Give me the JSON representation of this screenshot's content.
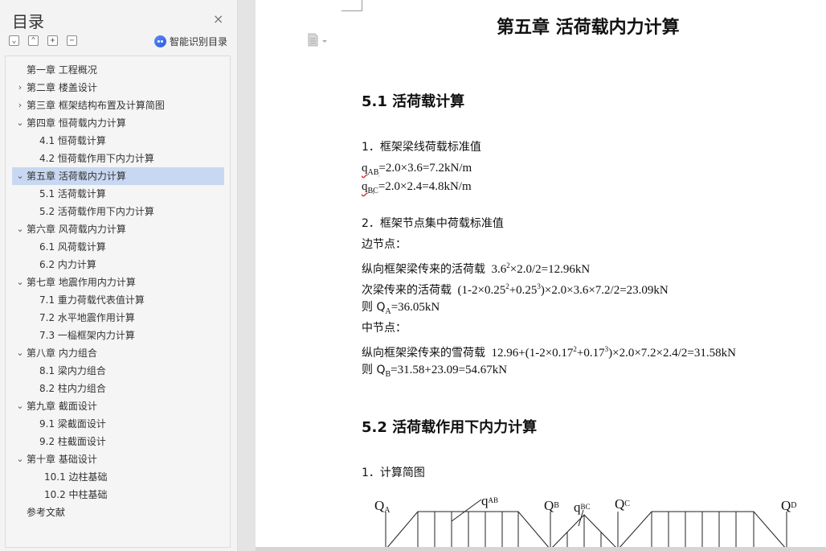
{
  "nav": {
    "title": "目录",
    "close_glyph": "×",
    "toolbar": {
      "collapse_all": "⌄",
      "expand_up": "⌃",
      "add": "+",
      "remove": "−"
    },
    "smart_toc_label": "智能识别目录",
    "toc": [
      {
        "text": "第一章  工程概况",
        "level": 1,
        "arrow": ""
      },
      {
        "text": "第二章  楼盖设计",
        "level": 1,
        "arrow": "›"
      },
      {
        "text": "第三章  框架结构布置及计算简图",
        "level": 1,
        "arrow": "›"
      },
      {
        "text": "第四章  恒荷载内力计算",
        "level": 1,
        "arrow": "⌄"
      },
      {
        "text": "4.1  恒荷载计算",
        "level": 2,
        "arrow": ""
      },
      {
        "text": "4.2  恒荷载作用下内力计算",
        "level": 2,
        "arrow": ""
      },
      {
        "text": "第五章  活荷载内力计算",
        "level": 1,
        "arrow": "⌄",
        "selected": true
      },
      {
        "text": "5.1  活荷载计算",
        "level": 2,
        "arrow": ""
      },
      {
        "text": "5.2  活荷载作用下内力计算",
        "level": 2,
        "arrow": ""
      },
      {
        "text": "第六章  风荷载内力计算",
        "level": 1,
        "arrow": "⌄"
      },
      {
        "text": "6.1  风荷载计算",
        "level": 2,
        "arrow": ""
      },
      {
        "text": "6.2  内力计算",
        "level": 2,
        "arrow": ""
      },
      {
        "text": "第七章  地震作用内力计算",
        "level": 1,
        "arrow": "⌄"
      },
      {
        "text": "7.1  重力荷载代表值计算",
        "level": 2,
        "arrow": ""
      },
      {
        "text": "7.2  水平地震作用计算",
        "level": 2,
        "arrow": ""
      },
      {
        "text": "7.3  一榀框架内力计算",
        "level": 2,
        "arrow": ""
      },
      {
        "text": "第八章  内力组合",
        "level": 1,
        "arrow": "⌄"
      },
      {
        "text": "8.1  梁内力组合",
        "level": 2,
        "arrow": ""
      },
      {
        "text": "8.2  柱内力组合",
        "level": 2,
        "arrow": ""
      },
      {
        "text": "第九章  截面设计",
        "level": 1,
        "arrow": "⌄"
      },
      {
        "text": "9.1  梁截面设计",
        "level": 2,
        "arrow": ""
      },
      {
        "text": "9.2  柱截面设计",
        "level": 2,
        "arrow": ""
      },
      {
        "text": "第十章  基础设计",
        "level": 1,
        "arrow": "⌄"
      },
      {
        "text": "10.1  边柱基础",
        "level": 3,
        "arrow": ""
      },
      {
        "text": "10.2  中柱基础",
        "level": 3,
        "arrow": ""
      },
      {
        "text": "参考文献",
        "level": 1,
        "arrow": ""
      }
    ]
  },
  "doc": {
    "chapter_title": "第五章  活荷载内力计算",
    "section1_title": "5.1  活荷载计算",
    "item1": "1．框架梁线荷载标准值",
    "qab_q": "q",
    "qab_sub": "AB",
    "qab_rest": "=2.0×3.6=7.2kN/m",
    "qbc_q": "q",
    "qbc_sub": "BC",
    "qbc_rest": "=2.0×2.4=4.8kN/m",
    "item2": "2．框架节点集中荷载标准值",
    "edge_node": "边节点：",
    "l1_label": "纵向框架梁传来的活荷载",
    "l1_a": "3.6",
    "l1_sup": "2",
    "l1_b": "×2.0/2=12.96kN",
    "l2_label": "次梁传来的活荷载",
    "l2_a": "(1-2×0.25",
    "l2_sup1": "2",
    "l2_b": "+0.25",
    "l2_sup2": "3",
    "l2_c": ")×2.0×3.6×7.2/2=23.09kN",
    "qa_prefix": "则 Q",
    "qa_sub": "A",
    "qa_rest": "=36.05kN",
    "mid_node": "中节点：",
    "l3_label": "纵向框架梁传来的雪荷载",
    "l3_a": "12.96+(1-2×0.17",
    "l3_sup1": "2",
    "l3_b": "+0.17",
    "l3_sup2": "3",
    "l3_c": ")×2.0×7.2×2.4/2=31.58kN",
    "qb_prefix": "则 Q",
    "qb_sub": "B",
    "qb_rest": "=31.58+23.09=54.67kN",
    "section2_title": "5.2  活荷载作用下内力计算",
    "item3": "1．计算简图"
  },
  "diagram": {
    "labels": {
      "QA": {
        "main": "Q",
        "sub": "A"
      },
      "qAB": {
        "main": "q",
        "sub": "AB"
      },
      "QB": {
        "main": "Q",
        "sub": "B"
      },
      "qBC": {
        "main": "q",
        "sub": "BC"
      },
      "QC": {
        "main": "Q",
        "sub": "C"
      },
      "QD": {
        "main": "Q",
        "sub": "D"
      }
    }
  }
}
